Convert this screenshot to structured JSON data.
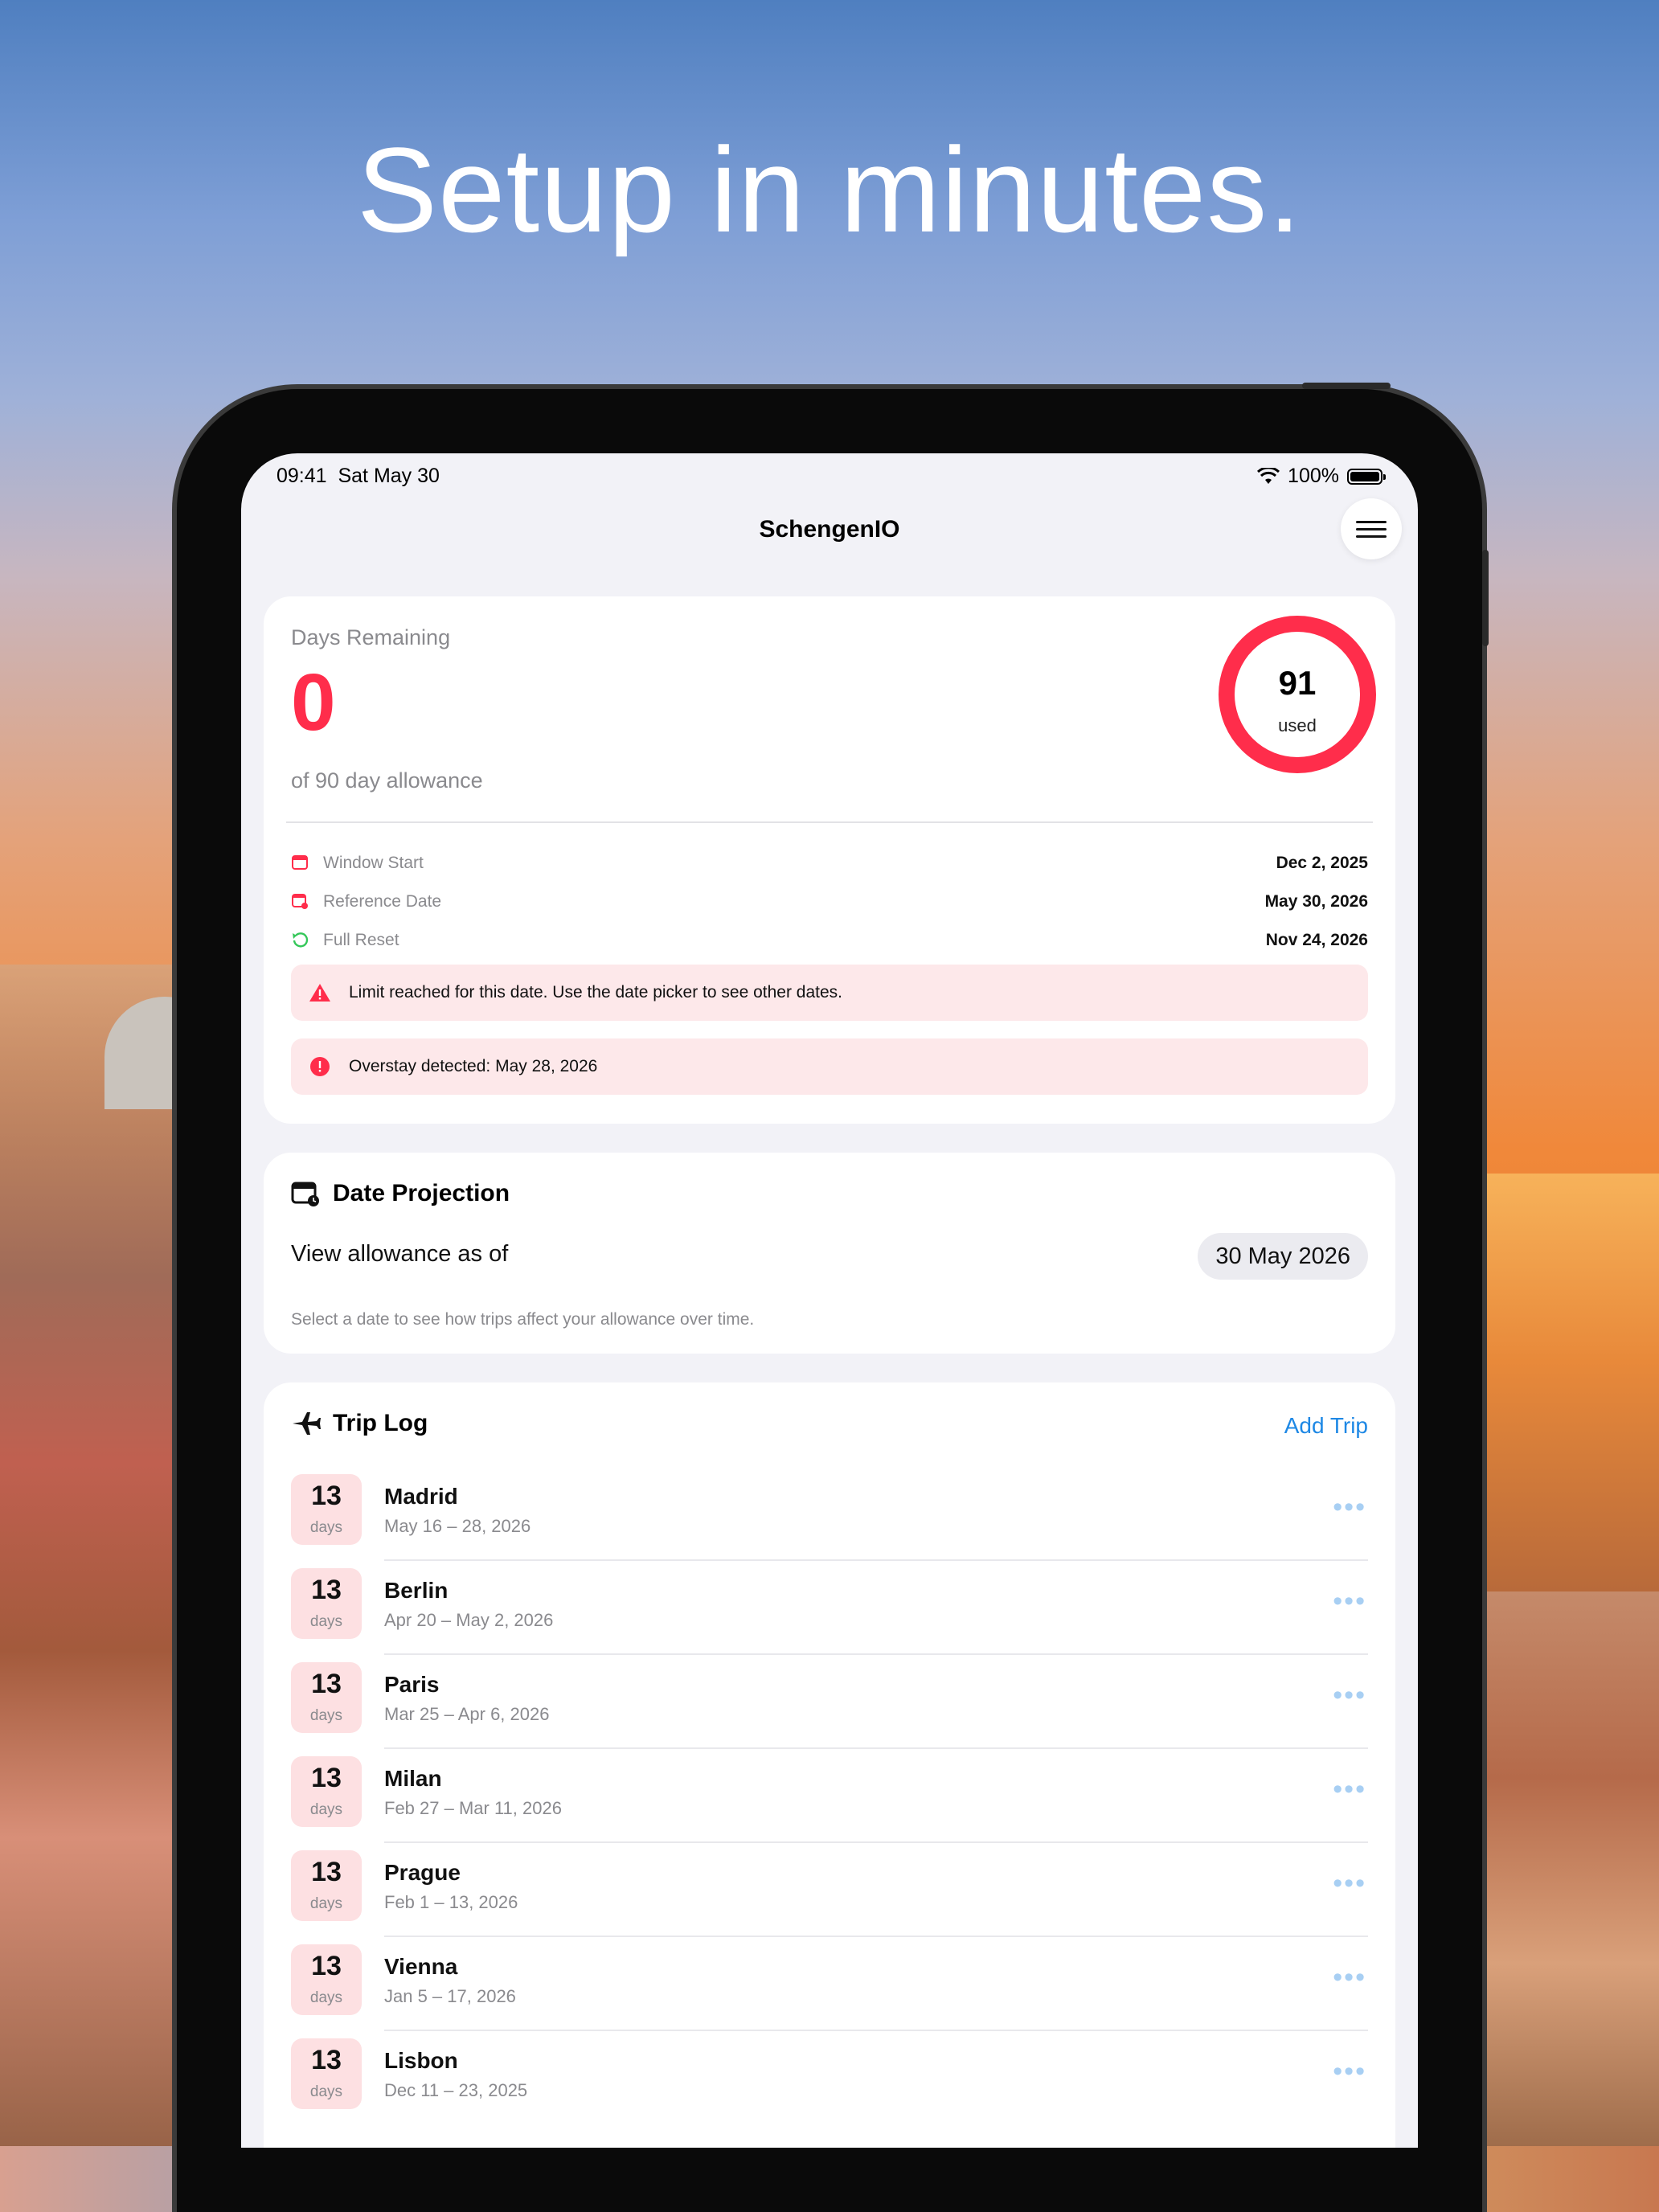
{
  "headline": "Setup in minutes.",
  "status_bar": {
    "time": "09:41",
    "date": "Sat May 30",
    "battery": "100%"
  },
  "app_title": "SchengenIO",
  "summary": {
    "days_remaining_label": "Days Remaining",
    "days_remaining_value": "0",
    "allowance_text": "of 90 day allowance",
    "ring_value": "91",
    "ring_label": "used",
    "rows": [
      {
        "label": "Window Start",
        "value": "Dec 2, 2025"
      },
      {
        "label": "Reference Date",
        "value": "May 30, 2026"
      },
      {
        "label": "Full Reset",
        "value": "Nov 24, 2026"
      }
    ],
    "alerts": [
      {
        "text": "Limit reached for this date. Use the date picker to see other dates."
      },
      {
        "text": "Overstay detected: May 28, 2026"
      }
    ]
  },
  "projection": {
    "title": "Date Projection",
    "view_label": "View allowance as of",
    "selected_date": "30 May 2026",
    "note": "Select a date to see how trips affect your allowance over time."
  },
  "trip_log": {
    "title": "Trip Log",
    "add_label": "Add Trip",
    "unit": "days",
    "trips": [
      {
        "days": "13",
        "city": "Madrid",
        "dates": "May 16 – 28, 2026"
      },
      {
        "days": "13",
        "city": "Berlin",
        "dates": "Apr 20 – May 2, 2026"
      },
      {
        "days": "13",
        "city": "Paris",
        "dates": "Mar 25 – Apr 6, 2026"
      },
      {
        "days": "13",
        "city": "Milan",
        "dates": "Feb 27 – Mar 11, 2026"
      },
      {
        "days": "13",
        "city": "Prague",
        "dates": "Feb 1 – 13, 2026"
      },
      {
        "days": "13",
        "city": "Vienna",
        "dates": "Jan 5 – 17, 2026"
      },
      {
        "days": "13",
        "city": "Lisbon",
        "dates": "Dec 11 – 23, 2025"
      }
    ]
  },
  "colors": {
    "accent_red": "#ff2d4b",
    "link_blue": "#1e88e5",
    "alert_bg": "#fde8ea",
    "reset_green": "#34c759"
  },
  "icons": {
    "wifi": "wifi-icon",
    "battery": "battery-icon",
    "menu": "hamburger-menu-icon",
    "window_start": "calendar-icon",
    "reference_date": "calendar-badge-icon",
    "full_reset": "reset-arrow-icon",
    "limit_alert": "warning-triangle-icon",
    "overstay_alert": "exclamation-circle-icon",
    "projection": "calendar-clock-icon",
    "trip_log": "airplane-icon",
    "trip_more": "ellipsis-icon"
  }
}
